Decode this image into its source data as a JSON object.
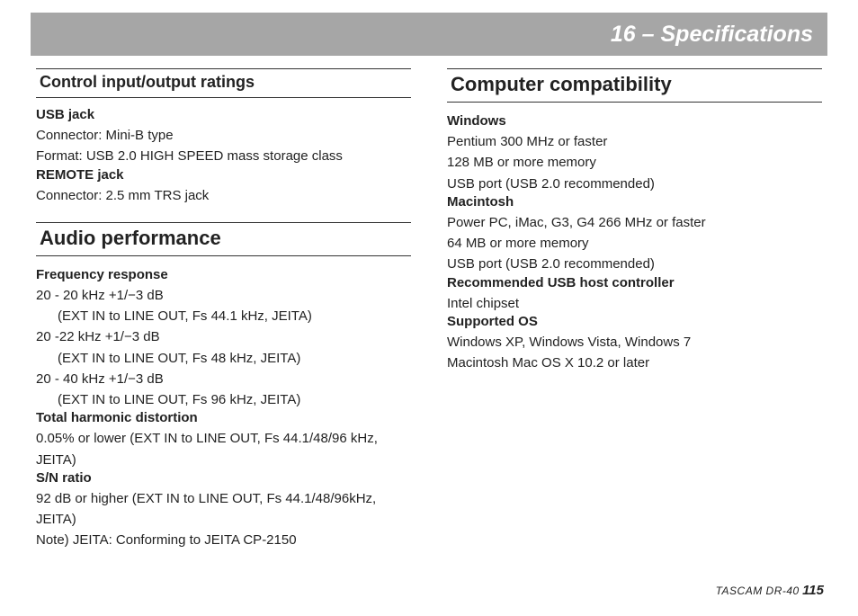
{
  "header": {
    "title": "16 – Specifications"
  },
  "left": {
    "section1": {
      "heading": "Control input/output ratings",
      "groups": [
        {
          "title": "USB jack",
          "lines": [
            "Connector: Mini-B type",
            "Format: USB 2.0 HIGH SPEED mass storage class"
          ]
        },
        {
          "title": "REMOTE jack",
          "lines": [
            "Connector: 2.5 mm TRS jack"
          ]
        }
      ]
    },
    "section2": {
      "heading": "Audio performance",
      "groups": [
        {
          "title": "Frequency response",
          "lines_mixed": [
            {
              "text": "20 - 20 kHz +1/−3 dB",
              "indent": false
            },
            {
              "text": "(EXT IN to LINE OUT, Fs 44.1 kHz, JEITA)",
              "indent": true
            },
            {
              "text": "20 -22 kHz +1/−3 dB",
              "indent": false
            },
            {
              "text": "(EXT IN to LINE OUT, Fs 48 kHz, JEITA)",
              "indent": true
            },
            {
              "text": "20 - 40 kHz +1/−3 dB",
              "indent": false
            },
            {
              "text": "(EXT IN to LINE OUT, Fs 96 kHz, JEITA)",
              "indent": true
            }
          ]
        },
        {
          "title": "Total harmonic distortion",
          "lines": [
            "0.05% or lower (EXT IN to LINE OUT, Fs 44.1/48/96 kHz, JEITA)"
          ]
        },
        {
          "title": "S/N ratio",
          "lines": [
            "92 dB or higher (EXT IN to LINE OUT, Fs 44.1/48/96kHz, JEITA)",
            "Note) JEITA: Conforming to JEITA CP-2150"
          ]
        }
      ]
    }
  },
  "right": {
    "section1": {
      "heading": "Computer compatibility",
      "groups": [
        {
          "title": "Windows",
          "lines": [
            "Pentium 300 MHz or faster",
            "128 MB or more memory",
            "USB port (USB 2.0 recommended)"
          ]
        },
        {
          "title": "Macintosh",
          "lines": [
            "Power PC, iMac, G3, G4 266 MHz or faster",
            "64 MB or more memory",
            "USB port (USB 2.0 recommended)"
          ]
        },
        {
          "title": "Recommended USB host controller",
          "lines": [
            "Intel chipset"
          ]
        },
        {
          "title": "Supported OS",
          "lines": [
            "Windows XP, Windows Vista, Windows 7",
            "Macintosh Mac OS X 10.2 or later"
          ]
        }
      ]
    }
  },
  "footer": {
    "model": "TASCAM DR-40",
    "page": "115"
  }
}
